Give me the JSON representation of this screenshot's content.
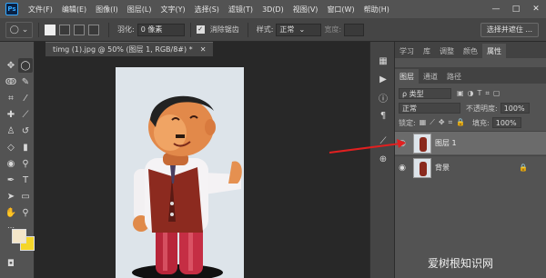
{
  "app": {
    "logo": "Ps"
  },
  "menu": [
    "文件(F)",
    "编辑(E)",
    "图像(I)",
    "图层(L)",
    "文字(Y)",
    "选择(S)",
    "滤镜(T)",
    "3D(D)",
    "视图(V)",
    "窗口(W)",
    "帮助(H)"
  ],
  "window_controls": [
    "—",
    "□",
    "✕"
  ],
  "options": {
    "tool_symbol": "◯",
    "feather_label": "羽化:",
    "feather_value": "0 像素",
    "antialias_label": "消除锯齿",
    "style_label": "样式:",
    "style_value": "正常",
    "width_label": "宽度:",
    "select_mask": "选择并遮住 ..."
  },
  "document": {
    "tab_title": "timg (1).jpg @ 50% (图层 1, RGB/8#) *",
    "close": "✕"
  },
  "panels": {
    "top_tabs": [
      "学习",
      "库",
      "调整",
      "颜色",
      "属性"
    ],
    "top_active": 4,
    "layers_tabs": [
      "图层",
      "通道",
      "路径"
    ],
    "layers_active": 0,
    "filter_label": "ρ 类型",
    "blend_mode": "正常",
    "opacity_label": "不透明度:",
    "opacity_value": "100%",
    "lock_label": "锁定:",
    "fill_label": "填充:",
    "fill_value": "100%",
    "layers": [
      {
        "name": "图层 1",
        "selected": true
      },
      {
        "name": "背景",
        "selected": false,
        "locked": true
      }
    ]
  },
  "colors": {
    "foreground": "#f4e6c8",
    "background": "#f5d62a",
    "arrow": "#e02020"
  },
  "watermark": "爱树根知识网"
}
